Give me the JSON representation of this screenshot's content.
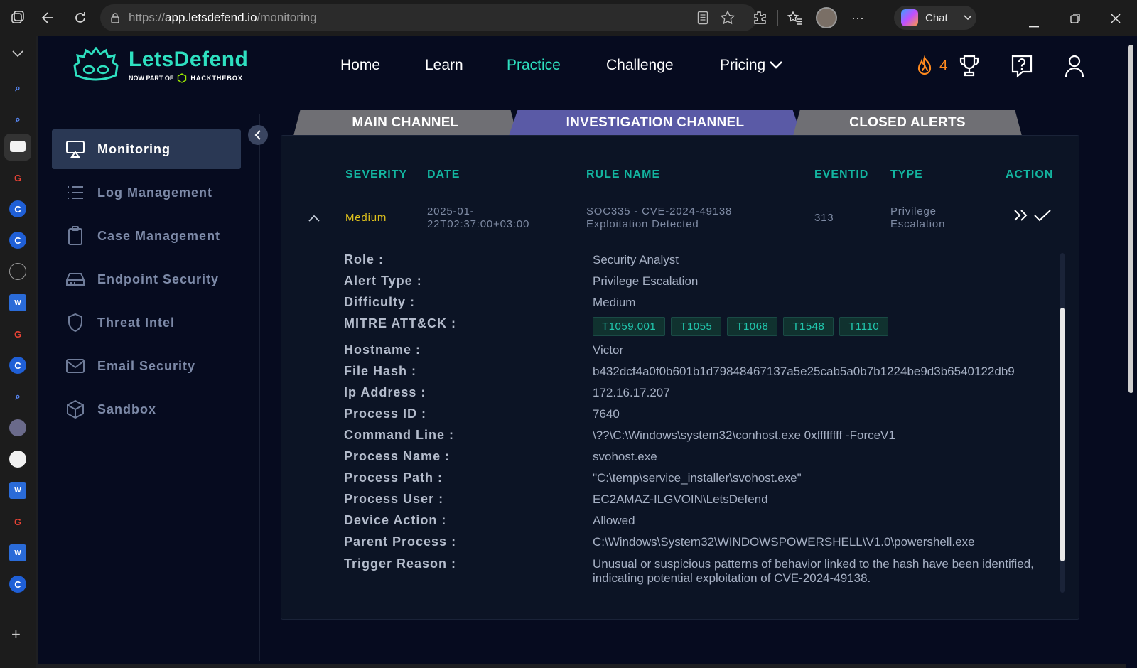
{
  "browser": {
    "url_prefix": "https://",
    "url_host": "app.letsdefend.io",
    "url_path": "/monitoring",
    "chat_label": "Chat"
  },
  "brand": {
    "name": "LetsDefend",
    "sub_prefix": "NOW PART OF",
    "sub_brand": "HACKTHEBOX",
    "accent": "#2ee0c0"
  },
  "nav": {
    "home": "Home",
    "learn": "Learn",
    "practice": "Practice",
    "challenge": "Challenge",
    "pricing": "Pricing"
  },
  "header": {
    "streak_count": "4"
  },
  "sidebar": {
    "items": [
      {
        "label": "Monitoring"
      },
      {
        "label": "Log Management"
      },
      {
        "label": "Case Management"
      },
      {
        "label": "Endpoint Security"
      },
      {
        "label": "Threat Intel"
      },
      {
        "label": "Email Security"
      },
      {
        "label": "Sandbox"
      }
    ]
  },
  "tabs": {
    "main": "MAIN CHANNEL",
    "investigation": "INVESTIGATION CHANNEL",
    "closed": "CLOSED ALERTS"
  },
  "table": {
    "headers": {
      "severity": "SEVERITY",
      "date": "DATE",
      "rule_name": "RULE NAME",
      "eventid": "EVENTID",
      "type": "TYPE",
      "action": "ACTION"
    },
    "row": {
      "severity": "Medium",
      "date_line1": "2025-01-",
      "date_line2": "22T02:37:00+03:00",
      "rule_line1": "SOC335 - CVE-2024-49138",
      "rule_line2": "Exploitation Detected",
      "eventid": "313",
      "type_line1": "Privilege",
      "type_line2": "Escalation"
    }
  },
  "details": {
    "role_label": "Role :",
    "role": "Security Analyst",
    "alert_type_label": "Alert Type :",
    "alert_type": "Privilege Escalation",
    "difficulty_label": "Difficulty :",
    "difficulty": "Medium",
    "mitre_label": "MITRE ATT&CK :",
    "mitre": [
      "T1059.001",
      "T1055",
      "T1068",
      "T1548",
      "T1110"
    ],
    "hostname_label": "Hostname :",
    "hostname": "Victor",
    "file_hash_label": "File Hash :",
    "file_hash": "b432dcf4a0f0b601b1d79848467137a5e25cab5a0b7b1224be9d3b6540122db9",
    "ip_label": "Ip Address :",
    "ip": "172.16.17.207",
    "pid_label": "Process ID :",
    "pid": "7640",
    "cmd_label": "Command Line :",
    "cmd": "\\??\\C:\\Windows\\system32\\conhost.exe 0xffffffff -ForceV1",
    "pname_label": "Process Name :",
    "pname": "svohost.exe",
    "ppath_label": "Process Path :",
    "ppath": "\"C:\\temp\\service_installer\\svohost.exe\"",
    "puser_label": "Process User :",
    "puser": "EC2AMAZ-ILGVOIN\\LetsDefend",
    "action_label": "Device Action :",
    "action": "Allowed",
    "parent_label": "Parent Process :",
    "parent": "C:\\Windows\\System32\\WINDOWSPOWERSHELL\\V1.0\\powershell.exe",
    "trigger_label": "Trigger Reason :",
    "trigger": "Unusual or suspicious patterns of behavior linked to the hash have been identified, indicating potential exploitation of CVE-2024-49138."
  }
}
